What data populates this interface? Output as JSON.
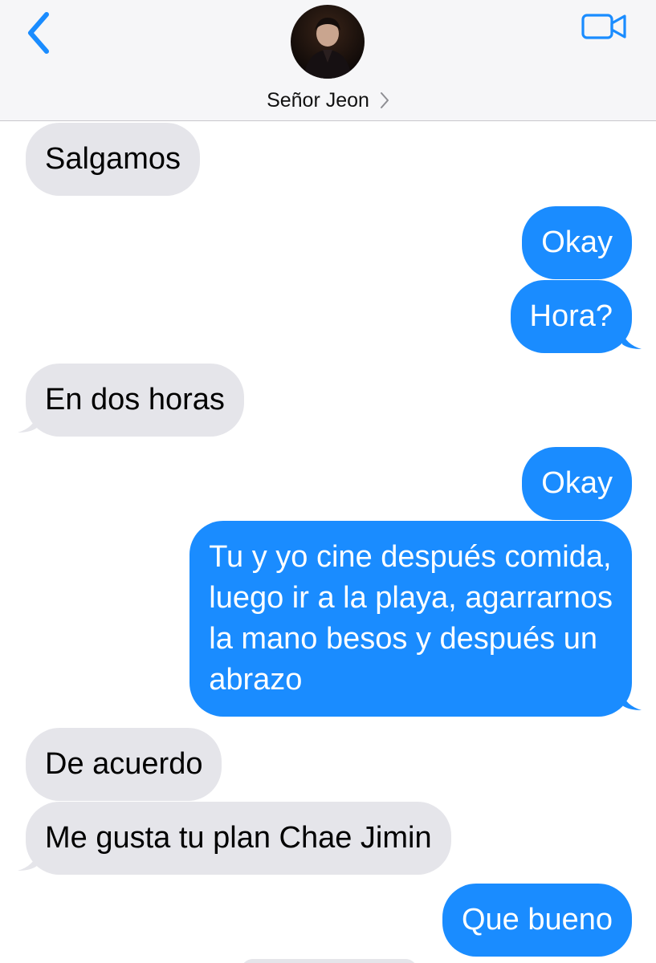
{
  "colors": {
    "accent": "#1a8cff",
    "incoming_bubble": "#e5e5ea",
    "header_bg": "#f6f6f8"
  },
  "header": {
    "back_icon": "chevron-left-icon",
    "video_icon": "video-camera-icon",
    "contact_name": "Señor Jeon",
    "name_chevron_icon": "chevron-right-icon"
  },
  "messages": [
    {
      "direction": "incoming",
      "text": "Salgamos"
    },
    {
      "direction": "outgoing",
      "text": "Okay"
    },
    {
      "direction": "outgoing",
      "text": "Hora?"
    },
    {
      "direction": "incoming",
      "text": "En dos horas"
    },
    {
      "direction": "outgoing",
      "text": "Okay"
    },
    {
      "direction": "outgoing",
      "text": "Tu y yo cine después comida,\nluego ir a la playa, agarrarnos\nla mano besos y después un\nabrazo"
    },
    {
      "direction": "incoming",
      "text": "De acuerdo"
    },
    {
      "direction": "incoming",
      "text": "Me gusta tu plan Chae Jimin"
    },
    {
      "direction": "outgoing",
      "text": "Que bueno"
    }
  ]
}
